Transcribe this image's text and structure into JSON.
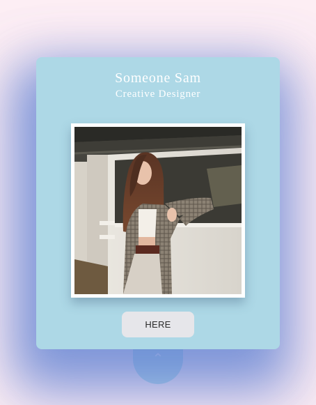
{
  "profile": {
    "name": "Someone Sam",
    "role": "Creative Designer",
    "photo": "portrait-photo"
  },
  "actions": {
    "button_label": "HERE",
    "toggle_icon": "chevron-up-icon",
    "toggle_glyph": "⌃"
  },
  "colors": {
    "background": "#fdeef4",
    "card": "#add8e6",
    "text": "#ffffff",
    "button": "#e6e6ea",
    "button_text": "#2a2a2a"
  }
}
